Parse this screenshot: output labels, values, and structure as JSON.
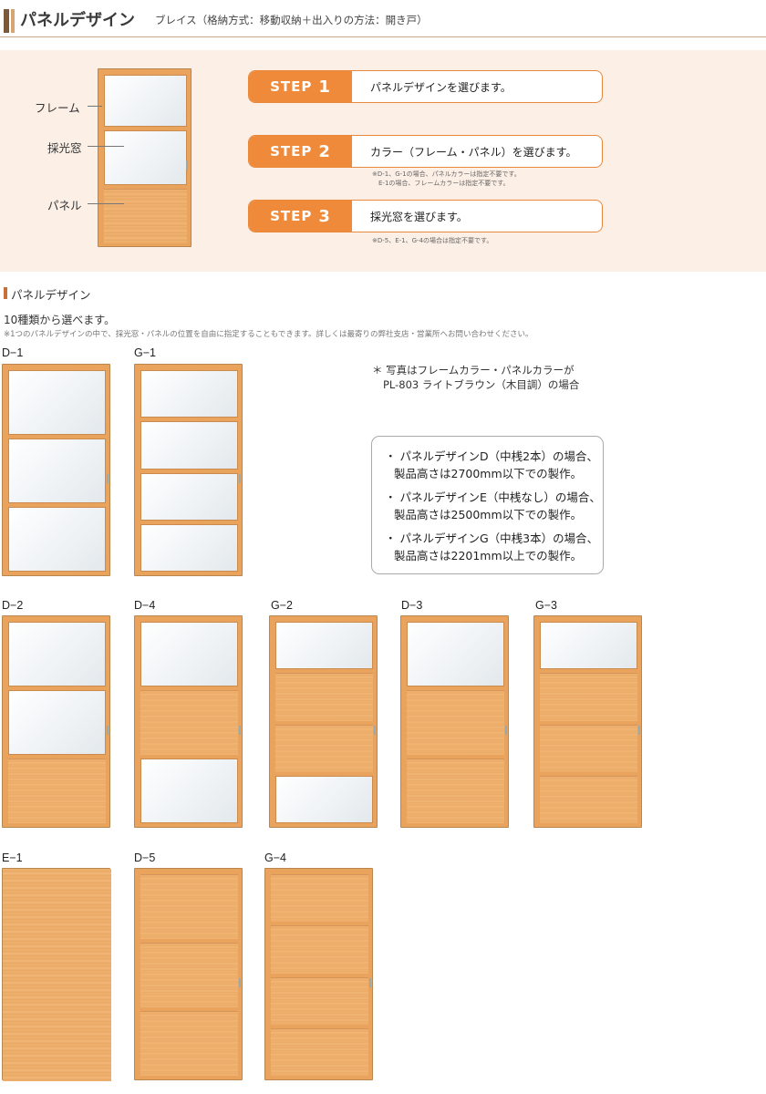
{
  "header": {
    "title": "パネルデザイン",
    "subtitle": "ブレイス（格納方式：移動収納＋出入りの方法：開き戸）"
  },
  "intro": {
    "labels": {
      "frame": "フレーム",
      "light_window": "採光窓",
      "panel": "パネル"
    },
    "steps": [
      {
        "prefix": "STEP",
        "num": "1",
        "text": "パネルデザインを選びます。",
        "notes": []
      },
      {
        "prefix": "STEP",
        "num": "2",
        "text": "カラー（フレーム・パネル）を選びます。",
        "notes": [
          "※D-1、G-1の場合、パネルカラーは指定不要です。",
          "E-1の場合、フレームカラーは指定不要です。"
        ]
      },
      {
        "prefix": "STEP",
        "num": "3",
        "text": "採光窓を選びます。",
        "notes": [
          "※D-5、E-1、G-4の場合は指定不要です。"
        ]
      }
    ]
  },
  "section": {
    "title": "パネルデザイン",
    "description": "10種類から選べます。",
    "note": "※1つのパネルデザインの中で、採光窓・パネルの位置を自由に指定することもできます。詳しくは最寄りの弊社支店・営業所へお問い合わせください。"
  },
  "photo_note": {
    "line1": "＊ 写真はフレームカラー・パネルカラーが",
    "line2": "PL-803 ライトブラウン（木目調）の場合"
  },
  "notes_box": {
    "items": [
      {
        "line1": "・ パネルデザインD（中桟2本）の場合、",
        "line2": "製品高さは2700mm以下での製作。"
      },
      {
        "line1": "・ パネルデザインE（中桟なし）の場合、",
        "line2": "製品高さは2500mm以下での製作。"
      },
      {
        "line1": "・ パネルデザインG（中桟3本）の場合、",
        "line2": "製品高さは2201mm以上での製作。"
      }
    ]
  },
  "designs": [
    {
      "code": "D-1",
      "layout": [
        "glass",
        "glass",
        "glass"
      ]
    },
    {
      "code": "G-1",
      "layout": [
        "glass",
        "glass",
        "glass",
        "glass"
      ]
    },
    {
      "code": "D-2",
      "layout": [
        "glass",
        "glass",
        "panel"
      ]
    },
    {
      "code": "D-4",
      "layout": [
        "glass",
        "panel",
        "glass"
      ]
    },
    {
      "code": "G-2",
      "layout": [
        "glass",
        "panel",
        "panel",
        "glass"
      ]
    },
    {
      "code": "D-3",
      "layout": [
        "glass",
        "panel",
        "panel"
      ]
    },
    {
      "code": "G-3",
      "layout": [
        "glass",
        "panel",
        "panel",
        "panel"
      ]
    },
    {
      "code": "E-1",
      "layout": [
        "panel"
      ]
    },
    {
      "code": "D-5",
      "layout": [
        "panel",
        "panel",
        "panel"
      ]
    },
    {
      "code": "G-4",
      "layout": [
        "panel",
        "panel",
        "panel",
        "panel"
      ]
    }
  ],
  "colors": {
    "accent": "#ef8a3a",
    "frame": "#e9a35c",
    "intro_bg": "#fcefe6"
  }
}
